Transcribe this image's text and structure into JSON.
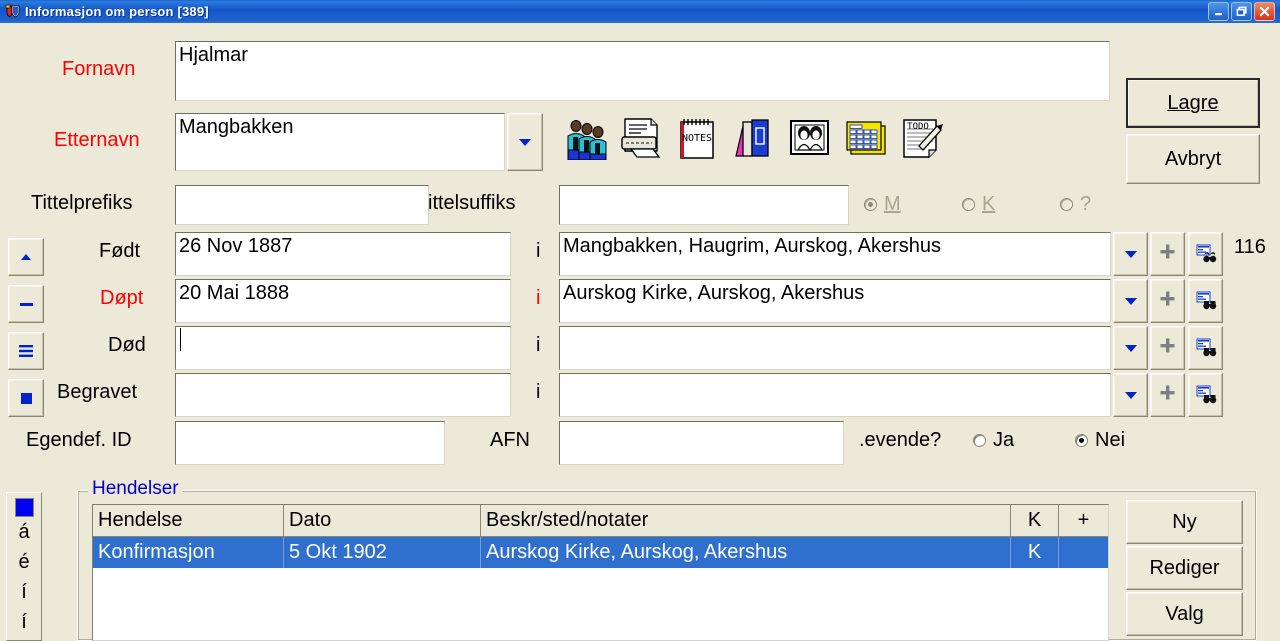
{
  "window": {
    "title": "Informasjon om person  [389]",
    "icon": "app-shield-icon",
    "minimize_label": "Minimize",
    "restore_label": "Restore",
    "close_label": "Close",
    "titlebar_color": "#1557c8",
    "face_color": "#ece9d8",
    "selection_color": "#2f6fce",
    "required_label_color": "#ff0000",
    "group_title_color": "#0000cd"
  },
  "form": {
    "fornavn": {
      "label": "Fornavn",
      "value": "Hjalmar"
    },
    "etternavn": {
      "label": "Etternavn",
      "value": "Mangbakken"
    },
    "tittelprefiks": {
      "label": "Tittelprefiks",
      "value": ""
    },
    "tittelsuffiks": {
      "label": "ittelsuffiks",
      "value": ""
    },
    "gender": {
      "options": [
        {
          "label": "M",
          "selected": true
        },
        {
          "label": "K",
          "selected": false
        },
        {
          "label": "?",
          "selected": false
        }
      ]
    },
    "events": [
      {
        "label": "Født",
        "date": "26 Nov 1887",
        "sep": "i",
        "place": "Mangbakken, Haugrim, Aurskog, Akershus",
        "required": false
      },
      {
        "label": "Døpt",
        "date": "20 Mai 1888",
        "sep": "i",
        "place": "Aurskog Kirke, Aurskog, Akershus",
        "required": true
      },
      {
        "label": "Død",
        "date": "",
        "sep": "i",
        "place": "",
        "required": false
      },
      {
        "label": "Begravet",
        "date": "",
        "sep": "i",
        "place": "",
        "required": false
      }
    ],
    "age_counter": "116",
    "egendef_id": {
      "label": "Egendef. ID",
      "value": ""
    },
    "afn": {
      "label": "AFN",
      "value": ""
    },
    "levende": {
      "label": ".evende?",
      "options": [
        {
          "label": "Ja",
          "selected": false
        },
        {
          "label": "Nei",
          "selected": true
        }
      ]
    }
  },
  "toolbar": {
    "icons": [
      {
        "name": "family-people-icon",
        "title": "Familie"
      },
      {
        "name": "print-document-icon",
        "title": "Rapport"
      },
      {
        "name": "notes-pad-icon",
        "title": "Notater"
      },
      {
        "name": "books-icon",
        "title": "Kilder"
      },
      {
        "name": "photo-frame-icon",
        "title": "Bilder"
      },
      {
        "name": "calendar-grid-icon",
        "title": "Kalender"
      },
      {
        "name": "todo-note-icon",
        "title": "Oppgaver"
      }
    ]
  },
  "row_buttons": {
    "dropdown": "▼",
    "plus": "+",
    "search": "binoculars-icon"
  },
  "left_buttons": [
    {
      "name": "nav-up-button",
      "glyph": "▲"
    },
    {
      "name": "nav-minus-button",
      "glyph": "–"
    },
    {
      "name": "nav-list-button",
      "glyph": "≡"
    },
    {
      "name": "nav-stop-button",
      "glyph": "■"
    }
  ],
  "actions": {
    "lagre": "Lagre",
    "avbryt": "Avbryt",
    "ny": "Ny",
    "rediger": "Rediger",
    "valg": "Valg"
  },
  "hendelser": {
    "group_title": "Hendelser",
    "columns": [
      "Hendelse",
      "Dato",
      "Beskr/sted/notater",
      "K",
      "+"
    ],
    "rows": [
      {
        "hendelse": "Konfirmasjon",
        "dato": "5 Okt 1902",
        "beskrivelse": "Aurskog Kirke, Aurskog, Akershus",
        "k": "K",
        "plus": "",
        "selected": true
      }
    ]
  },
  "accent_bar": {
    "swatch_color": "#0000ee",
    "chars": [
      "á",
      "é",
      "í",
      "í"
    ]
  }
}
